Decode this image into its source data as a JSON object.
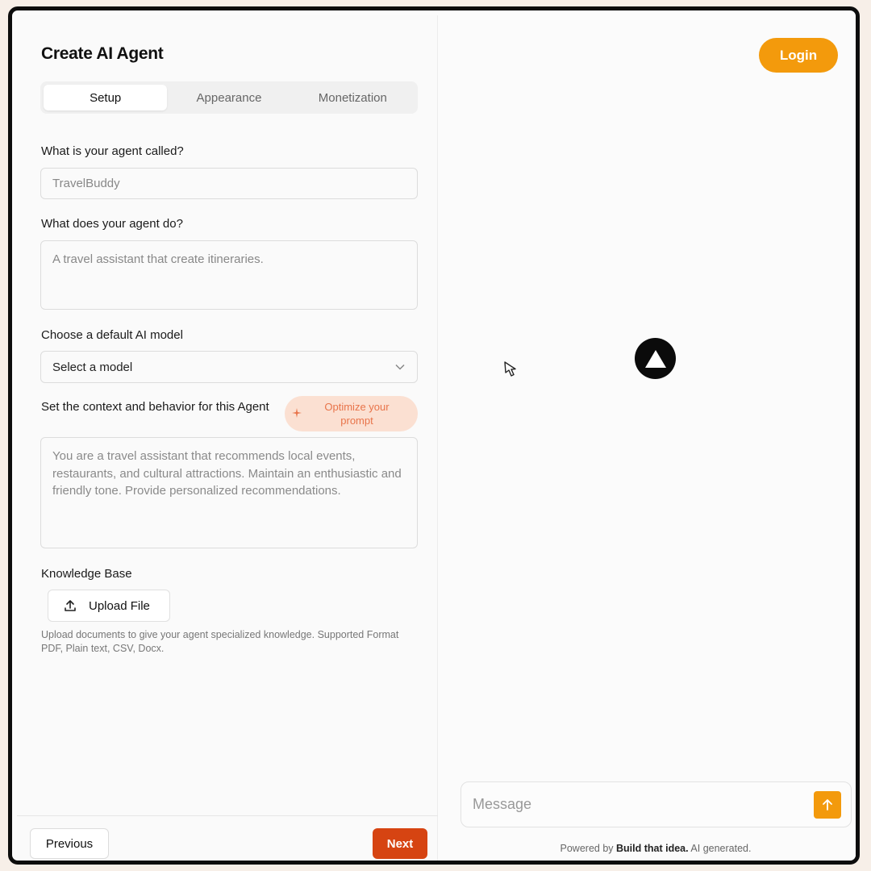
{
  "form": {
    "title": "Create AI Agent",
    "tabs": [
      {
        "label": "Setup",
        "active": true
      },
      {
        "label": "Appearance",
        "active": false
      },
      {
        "label": "Monetization",
        "active": false
      }
    ],
    "name_label": "What is your agent called?",
    "name_placeholder": "TravelBuddy",
    "description_label": "What does your agent do?",
    "description_placeholder": "A travel assistant that create itineraries.",
    "model_label": "Choose a default AI model",
    "model_select_value": "Select a model",
    "context_label": "Set the context and behavior for this Agent",
    "optimize_label": "Optimize your prompt",
    "context_placeholder": "You are a travel assistant that recommends local events, restaurants, and cultural attractions. Maintain an enthusiastic and friendly tone. Provide personalized recommendations.",
    "knowledge_label": "Knowledge Base",
    "upload_label": "Upload File",
    "upload_help": "Upload documents to give your agent specialized knowledge. Supported Format PDF, Plain text, CSV, Docx.",
    "previous_label": "Previous",
    "next_label": "Next"
  },
  "preview": {
    "login_label": "Login",
    "message_placeholder": "Message",
    "powered_prefix": "Powered by",
    "powered_brand": "Build that idea.",
    "powered_suffix": "AI generated."
  },
  "icons": {
    "dropdown": "chevron-down-icon",
    "optimize": "sparkle-icon",
    "upload": "upload-icon",
    "logo": "triangle-logo-icon",
    "cursor": "pointer-cursor-icon",
    "send": "arrow-up-icon"
  },
  "colors": {
    "login": "#f39a0c",
    "send": "#f39a0c",
    "next": "#d64412",
    "optimize_bg": "#fbe0d2",
    "optimize_text": "#e8744a",
    "frame_border": "#0d0d0d"
  }
}
